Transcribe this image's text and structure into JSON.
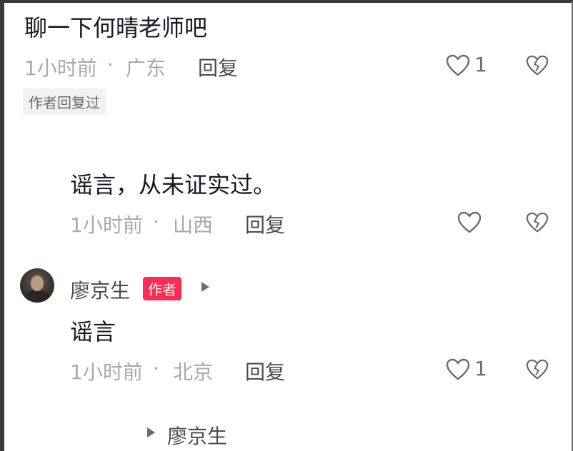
{
  "comment1": {
    "text": "聊一下何晴老师吧",
    "time": "1小时前",
    "sep": "·",
    "location": "广东",
    "reply_label": "回复",
    "like_count": "1",
    "tag": "作者回复过"
  },
  "reply1": {
    "text": "谣言，从未证实过。",
    "time": "1小时前",
    "sep": "·",
    "location": "山西",
    "reply_label": "回复"
  },
  "reply2": {
    "username": "廖京生",
    "author_badge": "作者",
    "text": "谣言",
    "time": "1小时前",
    "sep": "·",
    "location": "北京",
    "reply_label": "回复",
    "like_count": "1"
  },
  "more_replies": {
    "label": "廖京生"
  },
  "icons": {
    "like": "heart-outline-icon",
    "dislike": "broken-heart-icon",
    "arrow": "play-triangle-icon"
  },
  "colors": {
    "author_badge": "#fe2c55",
    "meta_text": "#a9a9ad"
  }
}
